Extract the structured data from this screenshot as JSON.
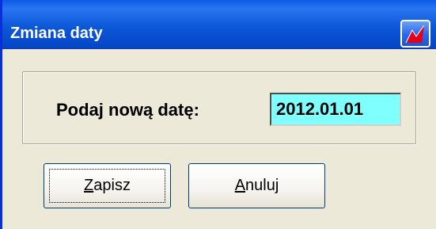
{
  "window": {
    "title": "Zmiana daty",
    "title_icon": "app-logo-icon",
    "accent": "#0b58d8"
  },
  "form": {
    "date_label": "Podaj nową datę:",
    "date_value": "2012.01.01",
    "date_bg": "#80ffff"
  },
  "buttons": {
    "save": {
      "accel": "Z",
      "rest": "apisz"
    },
    "cancel": {
      "accel": "A",
      "rest": "nuluj"
    }
  }
}
